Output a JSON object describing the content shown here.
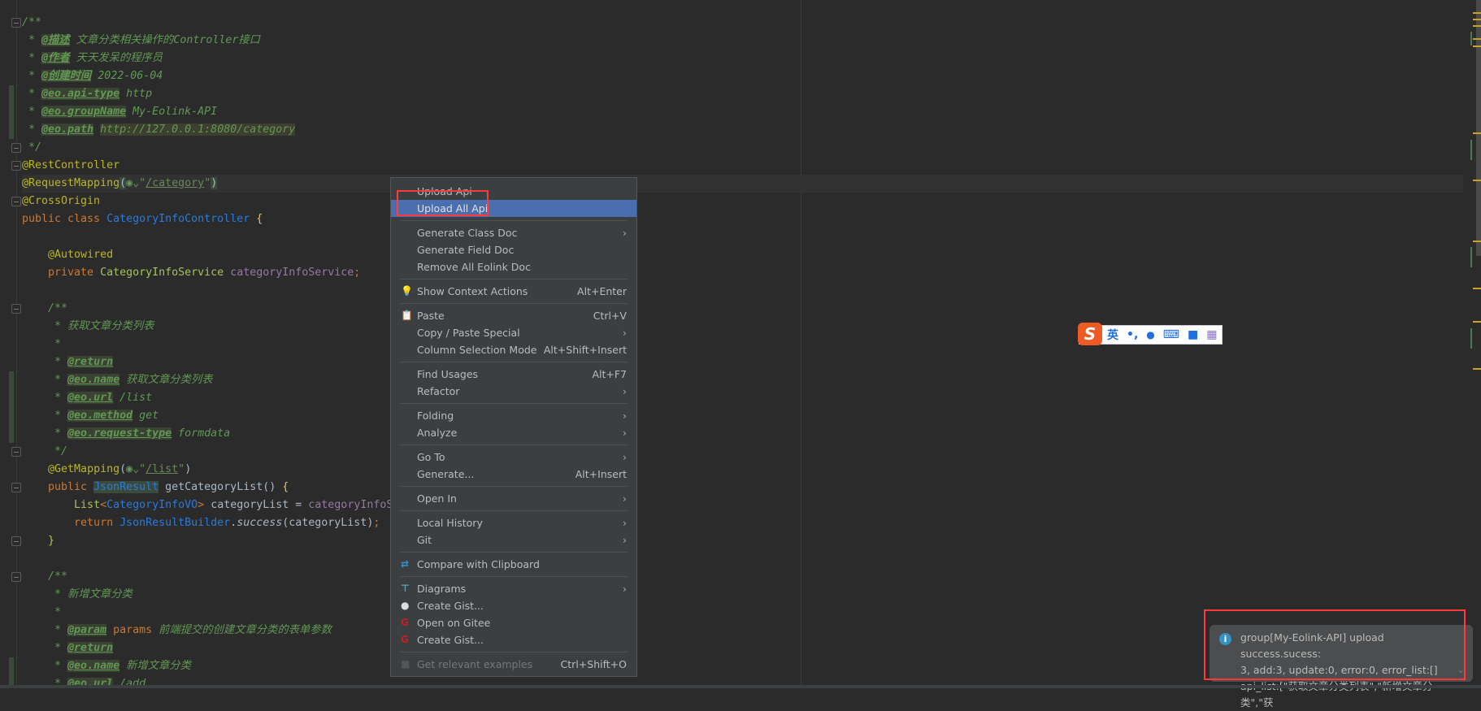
{
  "editor": {
    "current_line": 9,
    "lines": [
      [
        {
          "t": "/**",
          "c": "c"
        }
      ],
      [
        {
          "t": " * ",
          "c": "c"
        },
        {
          "t": "@描述",
          "c": "tag"
        },
        {
          "t": " 文章分类相关操作的Controller接口",
          "c": "c"
        }
      ],
      [
        {
          "t": " * ",
          "c": "c"
        },
        {
          "t": "@作者",
          "c": "tag"
        },
        {
          "t": " 天天发呆的程序员",
          "c": "c"
        }
      ],
      [
        {
          "t": " * ",
          "c": "c"
        },
        {
          "t": "@创建时间",
          "c": "tag"
        },
        {
          "t": " 2022-06-04",
          "c": "c"
        }
      ],
      [
        {
          "t": " * ",
          "c": "c"
        },
        {
          "t": "@eo.api-type",
          "c": "tag"
        },
        {
          "t": " http",
          "c": "c"
        }
      ],
      [
        {
          "t": " * ",
          "c": "c"
        },
        {
          "t": "@eo.groupName",
          "c": "tag"
        },
        {
          "t": " My-Eolink-API",
          "c": "c"
        }
      ],
      [
        {
          "t": " * ",
          "c": "c"
        },
        {
          "t": "@eo.path",
          "c": "tag"
        },
        {
          "t": " ",
          "c": "c"
        },
        {
          "t": "http://127.0.0.1:8080/category",
          "c": "tagv"
        }
      ],
      [
        {
          "t": " */",
          "c": "c"
        }
      ],
      [
        {
          "t": "@RestController",
          "c": "an"
        }
      ],
      [
        {
          "t": "@RequestMapping",
          "c": "an"
        },
        {
          "t": "(",
          "c": "hl"
        },
        {
          "t": "◉⌄",
          "c": "c"
        },
        {
          "t": "\"",
          "c": "str"
        },
        {
          "t": "/category",
          "c": "strl"
        },
        {
          "t": "\"",
          "c": "str"
        },
        {
          "t": ")",
          "c": "hl"
        }
      ],
      [
        {
          "t": "@CrossOrigin",
          "c": "an"
        }
      ],
      [
        {
          "t": "public class ",
          "c": "kw"
        },
        {
          "t": "CategoryInfoController ",
          "c": "cls"
        },
        {
          "t": "{",
          "c": "brace"
        }
      ],
      [],
      [
        {
          "t": "    "
        },
        {
          "t": "@Autowired",
          "c": "an"
        }
      ],
      [
        {
          "t": "    private ",
          "c": "kw"
        },
        {
          "t": "CategoryInfoService ",
          "c": "gr"
        },
        {
          "t": "categoryInfoService",
          "c": "fld"
        },
        {
          "t": ";",
          "c": "kw"
        }
      ],
      [],
      [
        {
          "t": "    /**",
          "c": "c"
        }
      ],
      [
        {
          "t": "     * 获取文章分类列表",
          "c": "c"
        }
      ],
      [
        {
          "t": "     *",
          "c": "c"
        }
      ],
      [
        {
          "t": "     * ",
          "c": "c"
        },
        {
          "t": "@return",
          "c": "tag"
        }
      ],
      [
        {
          "t": "     * ",
          "c": "c"
        },
        {
          "t": "@eo.name",
          "c": "tag"
        },
        {
          "t": " 获取文章分类列表",
          "c": "c"
        }
      ],
      [
        {
          "t": "     * ",
          "c": "c"
        },
        {
          "t": "@eo.url",
          "c": "tag"
        },
        {
          "t": " /list",
          "c": "c"
        }
      ],
      [
        {
          "t": "     * ",
          "c": "c"
        },
        {
          "t": "@eo.method",
          "c": "tag"
        },
        {
          "t": " get",
          "c": "c"
        }
      ],
      [
        {
          "t": "     * ",
          "c": "c"
        },
        {
          "t": "@eo.request-type",
          "c": "tag"
        },
        {
          "t": " formdata",
          "c": "c"
        }
      ],
      [
        {
          "t": "     */",
          "c": "c"
        }
      ],
      [
        {
          "t": "    "
        },
        {
          "t": "@GetMapping",
          "c": "an"
        },
        {
          "t": "("
        },
        {
          "t": "◉⌄",
          "c": "c"
        },
        {
          "t": "\"",
          "c": "str"
        },
        {
          "t": "/list",
          "c": "strl"
        },
        {
          "t": "\"",
          "c": "str"
        },
        {
          "t": ")"
        }
      ],
      [
        {
          "t": "    public ",
          "c": "kw"
        },
        {
          "t": "JsonResult",
          "c": "cls hl"
        },
        {
          "t": " getCategoryList() "
        },
        {
          "t": "{",
          "c": "brace"
        }
      ],
      [
        {
          "t": "        "
        },
        {
          "t": "List",
          "c": "gr"
        },
        {
          "t": "<",
          "c": "kw"
        },
        {
          "t": "CategoryInfoVO",
          "c": "cls"
        },
        {
          "t": "> ",
          "c": "kw"
        },
        {
          "t": "categoryList = "
        },
        {
          "t": "categoryInfoService",
          "c": "fld"
        }
      ],
      [
        {
          "t": "        return ",
          "c": "kw"
        },
        {
          "t": "JsonResultBuilder",
          "c": "cls"
        },
        {
          "t": "."
        },
        {
          "t": "success",
          "c": "it"
        },
        {
          "t": "(categoryList)"
        },
        {
          "t": ";",
          "c": "kw"
        }
      ],
      [
        {
          "t": "    "
        },
        {
          "t": "}",
          "c": "gr"
        }
      ],
      [],
      [
        {
          "t": "    /**",
          "c": "c"
        }
      ],
      [
        {
          "t": "     * 新增文章分类",
          "c": "c"
        }
      ],
      [
        {
          "t": "     *",
          "c": "c"
        }
      ],
      [
        {
          "t": "     * ",
          "c": "c"
        },
        {
          "t": "@param",
          "c": "tag"
        },
        {
          "t": " params",
          "c": "kw"
        },
        {
          "t": " 前端提交的创建文章分类的表单参数",
          "c": "c"
        }
      ],
      [
        {
          "t": "     * ",
          "c": "c"
        },
        {
          "t": "@return",
          "c": "tag"
        }
      ],
      [
        {
          "t": "     * ",
          "c": "c"
        },
        {
          "t": "@eo.name",
          "c": "tag"
        },
        {
          "t": " 新增文章分类",
          "c": "c"
        }
      ],
      [
        {
          "t": "     * ",
          "c": "c"
        },
        {
          "t": "@eo.url",
          "c": "tag"
        },
        {
          "t": " /add",
          "c": "c"
        }
      ]
    ]
  },
  "context_menu": {
    "groups": [
      [
        {
          "label": "Upload Api"
        },
        {
          "label": "Upload All Api",
          "selected": true
        }
      ],
      [
        {
          "label": "Generate Class Doc",
          "submenu": true
        },
        {
          "label": "Generate Field Doc"
        },
        {
          "label": "Remove All Eolink Doc"
        }
      ],
      [
        {
          "label": "Show Context Actions",
          "shortcut": "Alt+Enter",
          "icon": "lightbulb-icon"
        }
      ],
      [
        {
          "label": "Paste",
          "shortcut": "Ctrl+V",
          "icon": "clipboard-icon"
        },
        {
          "label": "Copy / Paste Special",
          "submenu": true
        },
        {
          "label": "Column Selection Mode",
          "shortcut": "Alt+Shift+Insert"
        }
      ],
      [
        {
          "label": "Find Usages",
          "shortcut": "Alt+F7"
        },
        {
          "label": "Refactor",
          "submenu": true
        }
      ],
      [
        {
          "label": "Folding",
          "submenu": true
        },
        {
          "label": "Analyze",
          "submenu": true
        }
      ],
      [
        {
          "label": "Go To",
          "submenu": true
        },
        {
          "label": "Generate...",
          "shortcut": "Alt+Insert"
        }
      ],
      [
        {
          "label": "Open In",
          "submenu": true
        }
      ],
      [
        {
          "label": "Local History",
          "submenu": true
        },
        {
          "label": "Git",
          "submenu": true
        }
      ],
      [
        {
          "label": "Compare with Clipboard",
          "icon": "compare-icon"
        }
      ],
      [
        {
          "label": "Diagrams",
          "submenu": true,
          "icon": "diagram-icon"
        },
        {
          "label": "Create Gist...",
          "icon": "github-icon"
        },
        {
          "label": "Open on Gitee",
          "icon": "gitee-icon"
        },
        {
          "label": "Create Gist...",
          "icon": "gitee-icon"
        }
      ],
      [
        {
          "label": "Get relevant examples",
          "shortcut": "Ctrl+Shift+O",
          "disabled": true,
          "icon": "examples-icon"
        }
      ]
    ],
    "submenu_arrow": "›"
  },
  "ime_toolbar": {
    "logo": "S",
    "lang": "英",
    "punct": "•,",
    "mic": "🎤",
    "keyboard": "⌨",
    "skin": "👕",
    "apps": "▦"
  },
  "notification": {
    "icon": "i",
    "lines": [
      "group[My-Eolink-API] upload success.sucess:",
      "3, add:3, update:0, error:0, error_list:[]",
      "api_list:[\"获取文章分类列表\",\"新增文章分类\",\"获"
    ],
    "expand": "⌄"
  },
  "colors": {
    "accent_selected": "#4b6eaf",
    "highlight_box": "#ff3b3b",
    "background": "#2b2b2b"
  }
}
